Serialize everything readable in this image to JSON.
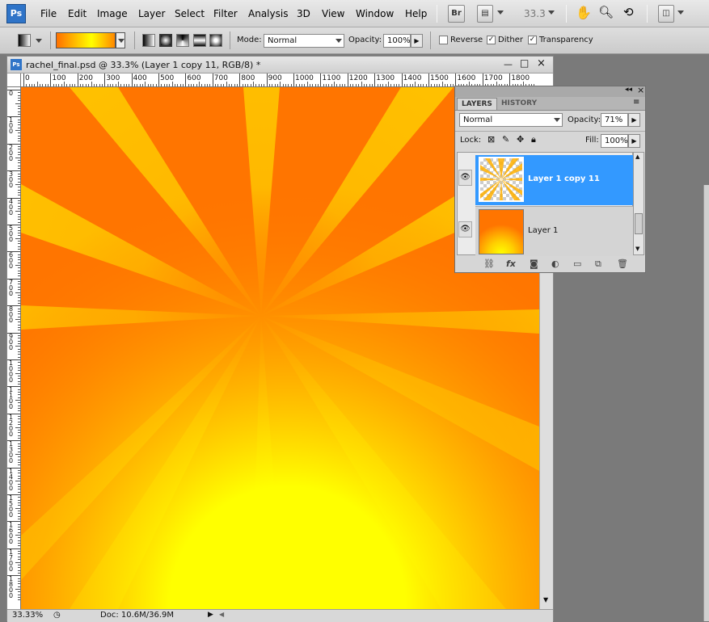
{
  "app": {
    "logo": "Ps"
  },
  "menu": {
    "items": [
      "File",
      "Edit",
      "Image",
      "Layer",
      "Select",
      "Filter",
      "Analysis",
      "3D",
      "View",
      "Window",
      "Help"
    ],
    "br": "Br",
    "zoom": "33.3"
  },
  "options": {
    "mode_label": "Mode:",
    "mode_value": "Normal",
    "opacity_label": "Opacity:",
    "opacity_value": "100%",
    "reverse_label": "Reverse",
    "dither_label": "Dither",
    "transparency_label": "Transparency",
    "reverse_checked": false,
    "dither_checked": true,
    "transparency_checked": true
  },
  "document": {
    "title": "rachel_final.psd @ 33.3% (Layer 1 copy 11, RGB/8) *",
    "zoom_status": "33.33%",
    "doc_info": "Doc: 10.6M/36.9M"
  },
  "ruler": {
    "h_labels": [
      "0",
      "100",
      "200",
      "300",
      "400",
      "500",
      "600",
      "700",
      "800",
      "900",
      "1000",
      "1100",
      "1200",
      "1300",
      "1400",
      "1500",
      "1600",
      "1700",
      "1800"
    ],
    "v_labels": [
      "0",
      "1 0 0",
      "2 0 0",
      "3 0 0",
      "4 0 0",
      "5 0 0",
      "6 0 0",
      "7 0 0",
      "8 0 0",
      "9 0 0",
      "1 0 0 0",
      "1 1 0 0",
      "1 2 0 0",
      "1 3 0 0",
      "1 4 0 0",
      "1 5 0 0",
      "1 6 0 0",
      "1 7 0 0",
      "1 8 0 0"
    ]
  },
  "layers_panel": {
    "tab_layers": "LAYERS",
    "tab_history": "HISTORY",
    "blend_mode": "Normal",
    "opacity_label": "Opacity:",
    "opacity_value": "71%",
    "lock_label": "Lock:",
    "fill_label": "Fill:",
    "fill_value": "100%",
    "layers": [
      {
        "name": "Layer 1 copy 11",
        "selected": true
      },
      {
        "name": "Layer 1",
        "selected": false
      }
    ],
    "footer_fx": "fx"
  },
  "colors": {
    "canvas_base": "#ff7500",
    "ray": "#ffc000",
    "glow": "#ffff00",
    "selection": "#3399ff"
  }
}
